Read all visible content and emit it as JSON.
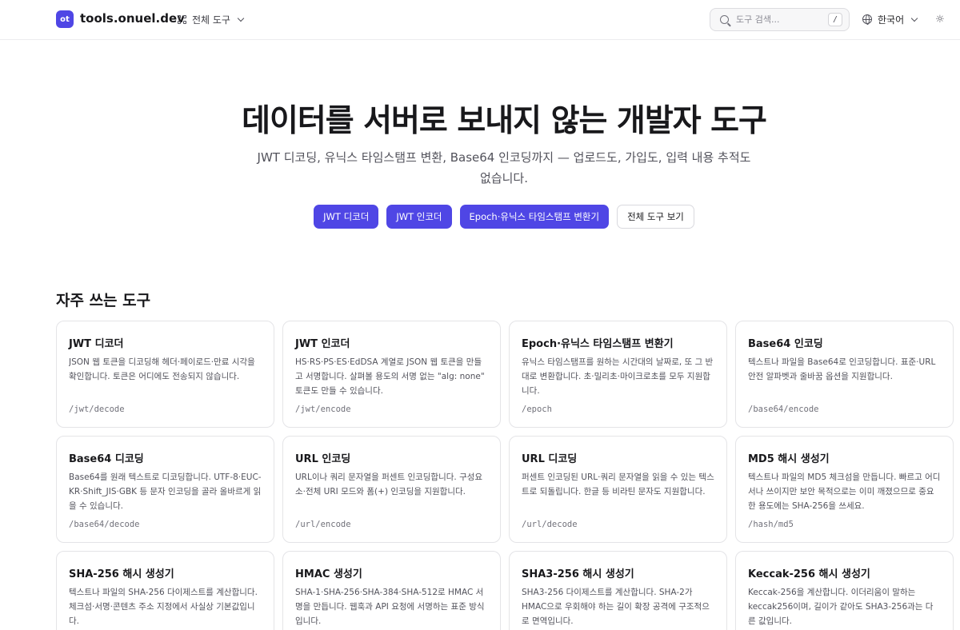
{
  "header": {
    "logo_text": "ot",
    "site_name": "tools.onuel.dev",
    "all_tools_label": "전체 도구",
    "search": {
      "placeholder": "도구 검색...",
      "shortcut": "/"
    },
    "language_label": "한국어"
  },
  "hero": {
    "title": "데이터를 서버로 보내지 않는 개발자 도구",
    "subtitle": "JWT 디코딩, 유닉스 타임스탬프 변환, Base64 인코딩까지 — 업로드도, 가입도, 입력 내용 추적도 없습니다.",
    "buttons": [
      {
        "label": "JWT 디코더",
        "style": "primary"
      },
      {
        "label": "JWT 인코더",
        "style": "primary"
      },
      {
        "label": "Epoch·유닉스 타임스탬프 변환기",
        "style": "primary"
      },
      {
        "label": "전체 도구 보기",
        "style": "secondary"
      }
    ]
  },
  "section": {
    "title": "자주 쓰는 도구",
    "tools": [
      {
        "title": "JWT 디코더",
        "description": "JSON 웹 토큰을 디코딩해 헤더·페이로드·만료 시각을 확인합니다. 토큰은 어디에도 전송되지 않습니다.",
        "path": "/jwt/decode"
      },
      {
        "title": "JWT 인코더",
        "description": "HS·RS·PS·ES·EdDSA 계열로 JSON 웹 토큰을 만들고 서명합니다. 살펴볼 용도의 서명 없는 \"alg: none\" 토큰도 만들 수 있습니다.",
        "path": "/jwt/encode"
      },
      {
        "title": "Epoch·유닉스 타임스탬프 변환기",
        "description": "유닉스 타임스탬프를 원하는 시간대의 날짜로, 또 그 반대로 변환합니다. 초·밀리초·마이크로초를 모두 지원합니다.",
        "path": "/epoch"
      },
      {
        "title": "Base64 인코딩",
        "description": "텍스트나 파일을 Base64로 인코딩합니다. 표준·URL 안전 알파벳과 줄바꿈 옵션을 지원합니다.",
        "path": "/base64/encode"
      },
      {
        "title": "Base64 디코딩",
        "description": "Base64를 원래 텍스트로 디코딩합니다. UTF-8·EUC-KR·Shift_JIS·GBK 등 문자 인코딩을 골라 올바르게 읽을 수 있습니다.",
        "path": "/base64/decode"
      },
      {
        "title": "URL 인코딩",
        "description": "URL이나 쿼리 문자열을 퍼센트 인코딩합니다. 구성요소·전체 URI 모드와 폼(+) 인코딩을 지원합니다.",
        "path": "/url/encode"
      },
      {
        "title": "URL 디코딩",
        "description": "퍼센트 인코딩된 URL·쿼리 문자열을 읽을 수 있는 텍스트로 되돌립니다. 한글 등 비라틴 문자도 지원합니다.",
        "path": "/url/decode"
      },
      {
        "title": "MD5 해시 생성기",
        "description": "텍스트나 파일의 MD5 체크섬을 만듭니다. 빠르고 어디서나 쓰이지만 보안 목적으로는 이미 깨졌으므로 중요한 용도에는 SHA-256을 쓰세요.",
        "path": "/hash/md5"
      },
      {
        "title": "SHA-256 해시 생성기",
        "description": "텍스트나 파일의 SHA-256 다이제스트를 계산합니다. 체크섬·서명·콘텐츠 주소 지정에서 사실상 기본값입니다.",
        "path": ""
      },
      {
        "title": "HMAC 생성기",
        "description": "SHA-1·SHA-256·SHA-384·SHA-512로 HMAC 서명을 만듭니다. 웹훅과 API 요청에 서명하는 표준 방식입니다.",
        "path": ""
      },
      {
        "title": "SHA3-256 해시 생성기",
        "description": "SHA3-256 다이제스트를 계산합니다. SHA-2가 HMAC으로 우회해야 하는 길이 확장 공격에 구조적으로 면역입니다.",
        "path": ""
      },
      {
        "title": "Keccak-256 해시 생성기",
        "description": "Keccak-256을 계산합니다. 이더리움이 말하는 keccak256이며, 길이가 같아도 SHA3-256과는 다른 값입니다.",
        "path": ""
      }
    ]
  },
  "colors": {
    "accent": "#4f46e5",
    "text": "#18181b",
    "muted": "#52525b",
    "border": "#e4e4e7"
  }
}
